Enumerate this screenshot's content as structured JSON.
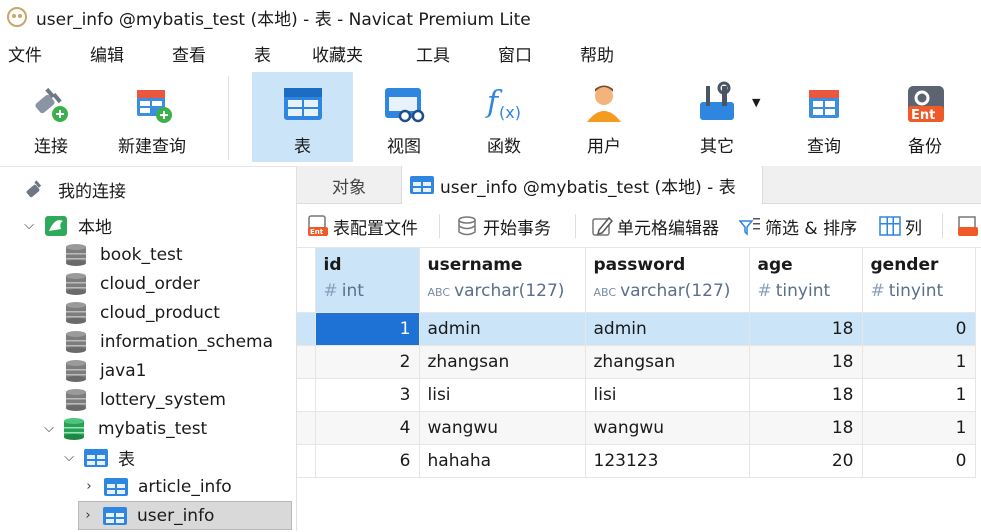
{
  "window": {
    "title": "user_info @mybatis_test (本地) - 表 - Navicat Premium Lite"
  },
  "menu": [
    "文件",
    "编辑",
    "查看",
    "表",
    "收藏夹",
    "工具",
    "窗口",
    "帮助"
  ],
  "toolbar": {
    "connect": "连接",
    "new_query": "新建查询",
    "table": "表",
    "view": "视图",
    "function": "函数",
    "user": "用户",
    "other": "其它",
    "query": "查询",
    "backup": "备份",
    "active": "table"
  },
  "tree": {
    "root_label": "我的连接",
    "connection": "本地",
    "databases": [
      "book_test",
      "cloud_order",
      "cloud_product",
      "information_schema",
      "java1",
      "lottery_system",
      "mybatis_test"
    ],
    "tables_folder": "表",
    "tables": [
      "article_info",
      "user_info"
    ],
    "selected_table": "user_info"
  },
  "tabs": {
    "objects": "对象",
    "current": "user_info @mybatis_test (本地) - 表"
  },
  "subtoolbar": {
    "table_config": "表配置文件",
    "begin_transaction": "开始事务",
    "cell_editor": "单元格编辑器",
    "filter_sort": "筛选 & 排序",
    "columns": "列"
  },
  "grid": {
    "columns": [
      {
        "name": "id",
        "type": "int",
        "type_icon": "#"
      },
      {
        "name": "username",
        "type": "varchar(127)",
        "type_icon": "ABC"
      },
      {
        "name": "password",
        "type": "varchar(127)",
        "type_icon": "ABC"
      },
      {
        "name": "age",
        "type": "tinyint",
        "type_icon": "#"
      },
      {
        "name": "gender",
        "type": "tinyint",
        "type_icon": "#"
      }
    ],
    "rows": [
      [
        "1",
        "admin",
        "admin",
        "18",
        "0"
      ],
      [
        "2",
        "zhangsan",
        "zhangsan",
        "18",
        "1"
      ],
      [
        "3",
        "lisi",
        "lisi",
        "18",
        "1"
      ],
      [
        "4",
        "wangwu",
        "wangwu",
        "18",
        "1"
      ],
      [
        "6",
        "hahaha",
        "123123",
        "20",
        "0"
      ]
    ]
  },
  "colors": {
    "accent": "#1e72d6",
    "selection": "#cce4f7",
    "db_green": "#2eaa5a"
  }
}
